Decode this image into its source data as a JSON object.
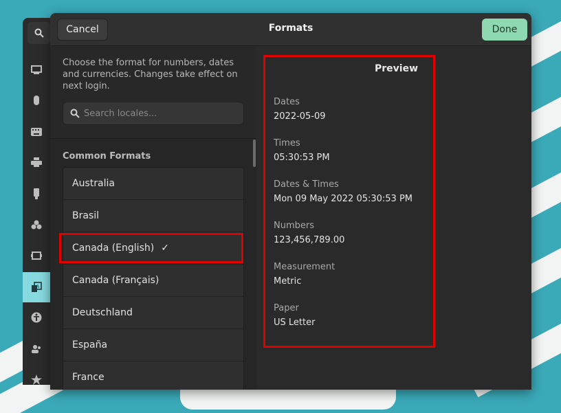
{
  "dialog": {
    "title": "Formats",
    "cancel_label": "Cancel",
    "done_label": "Done"
  },
  "left": {
    "intro": "Choose the format for numbers, dates and currencies. Changes take effect on next login.",
    "search_placeholder": "Search locales...",
    "section_title": "Common Formats",
    "items": [
      {
        "label": "Australia"
      },
      {
        "label": "Brasil"
      },
      {
        "label": "Canada (English)",
        "selected": true
      },
      {
        "label": "Canada (Français)"
      },
      {
        "label": "Deutschland"
      },
      {
        "label": "España"
      },
      {
        "label": "France"
      }
    ]
  },
  "preview": {
    "title": "Preview",
    "rows": [
      {
        "label": "Dates",
        "value": "2022-05-09"
      },
      {
        "label": "Times",
        "value": "05:30:53 PM"
      },
      {
        "label": "Dates & Times",
        "value": "Mon 09 May 2022 05:30:53 PM"
      },
      {
        "label": "Numbers",
        "value": "123,456,789.00"
      },
      {
        "label": "Measurement",
        "value": "Metric"
      },
      {
        "label": "Paper",
        "value": "US Letter"
      }
    ]
  },
  "sidebar": {
    "icons": [
      "display-icon",
      "mouse-icon",
      "keyboard-icon",
      "printer-icon",
      "removable-media-icon",
      "color-icon",
      "hardware-icon",
      "region-language-icon",
      "accessibility-icon",
      "users-icon",
      "star-icon"
    ],
    "active": "region-language-icon"
  },
  "colors": {
    "done_button": "#8fd9b0",
    "highlight": "#e00000",
    "wallpaper": "#3aa9b8"
  }
}
